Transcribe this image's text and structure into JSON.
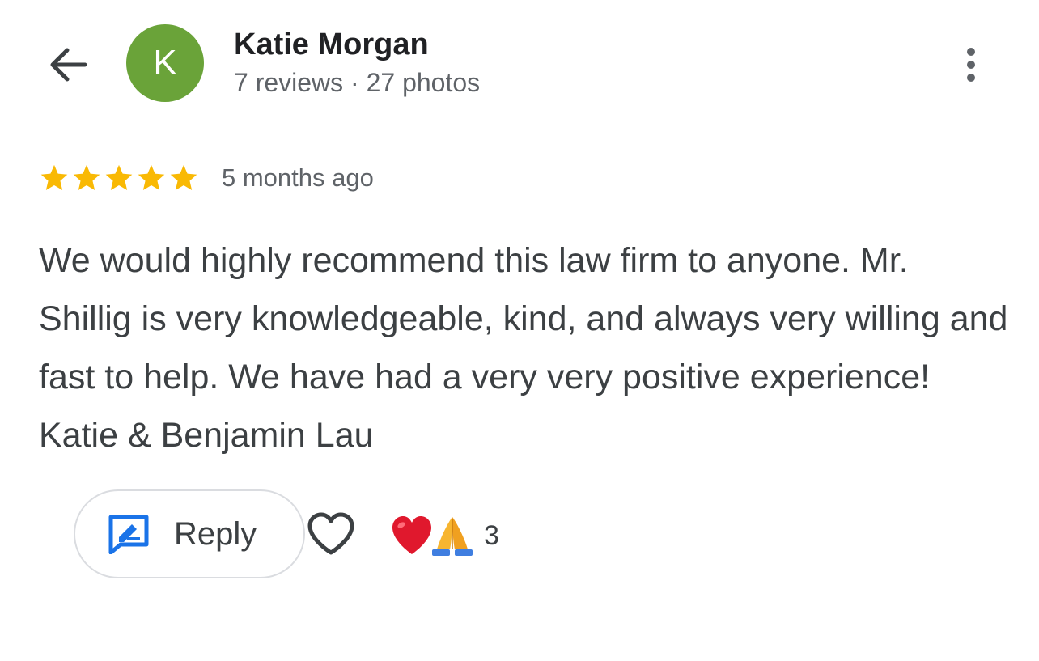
{
  "header": {
    "back_icon": "arrow-left-icon",
    "avatar_letter": "K",
    "author_name": "Katie Morgan",
    "author_stats": "7 reviews · 27 photos",
    "more_icon": "more-vert-icon"
  },
  "review": {
    "rating": 5,
    "rating_max": 5,
    "date": "5 months ago",
    "text": "We would highly recommend this law firm to anyone. Mr. Shillig is very knowledgeable, kind, and always very willing and fast to help. We have had a very very positive experience! Katie & Benjamin Lau"
  },
  "actions": {
    "reply_label": "Reply",
    "reply_icon": "reply-edit-icon",
    "like_icon": "heart-outline-icon",
    "reactions": [
      "red-heart-icon",
      "folded-hands-icon"
    ],
    "reaction_count": "3"
  },
  "colors": {
    "avatar": "#6aa339",
    "star": "#f9b904",
    "reply_icon": "#1a73e8",
    "heart_reaction": "#e0182d",
    "pray_reaction": "#f7b530"
  }
}
